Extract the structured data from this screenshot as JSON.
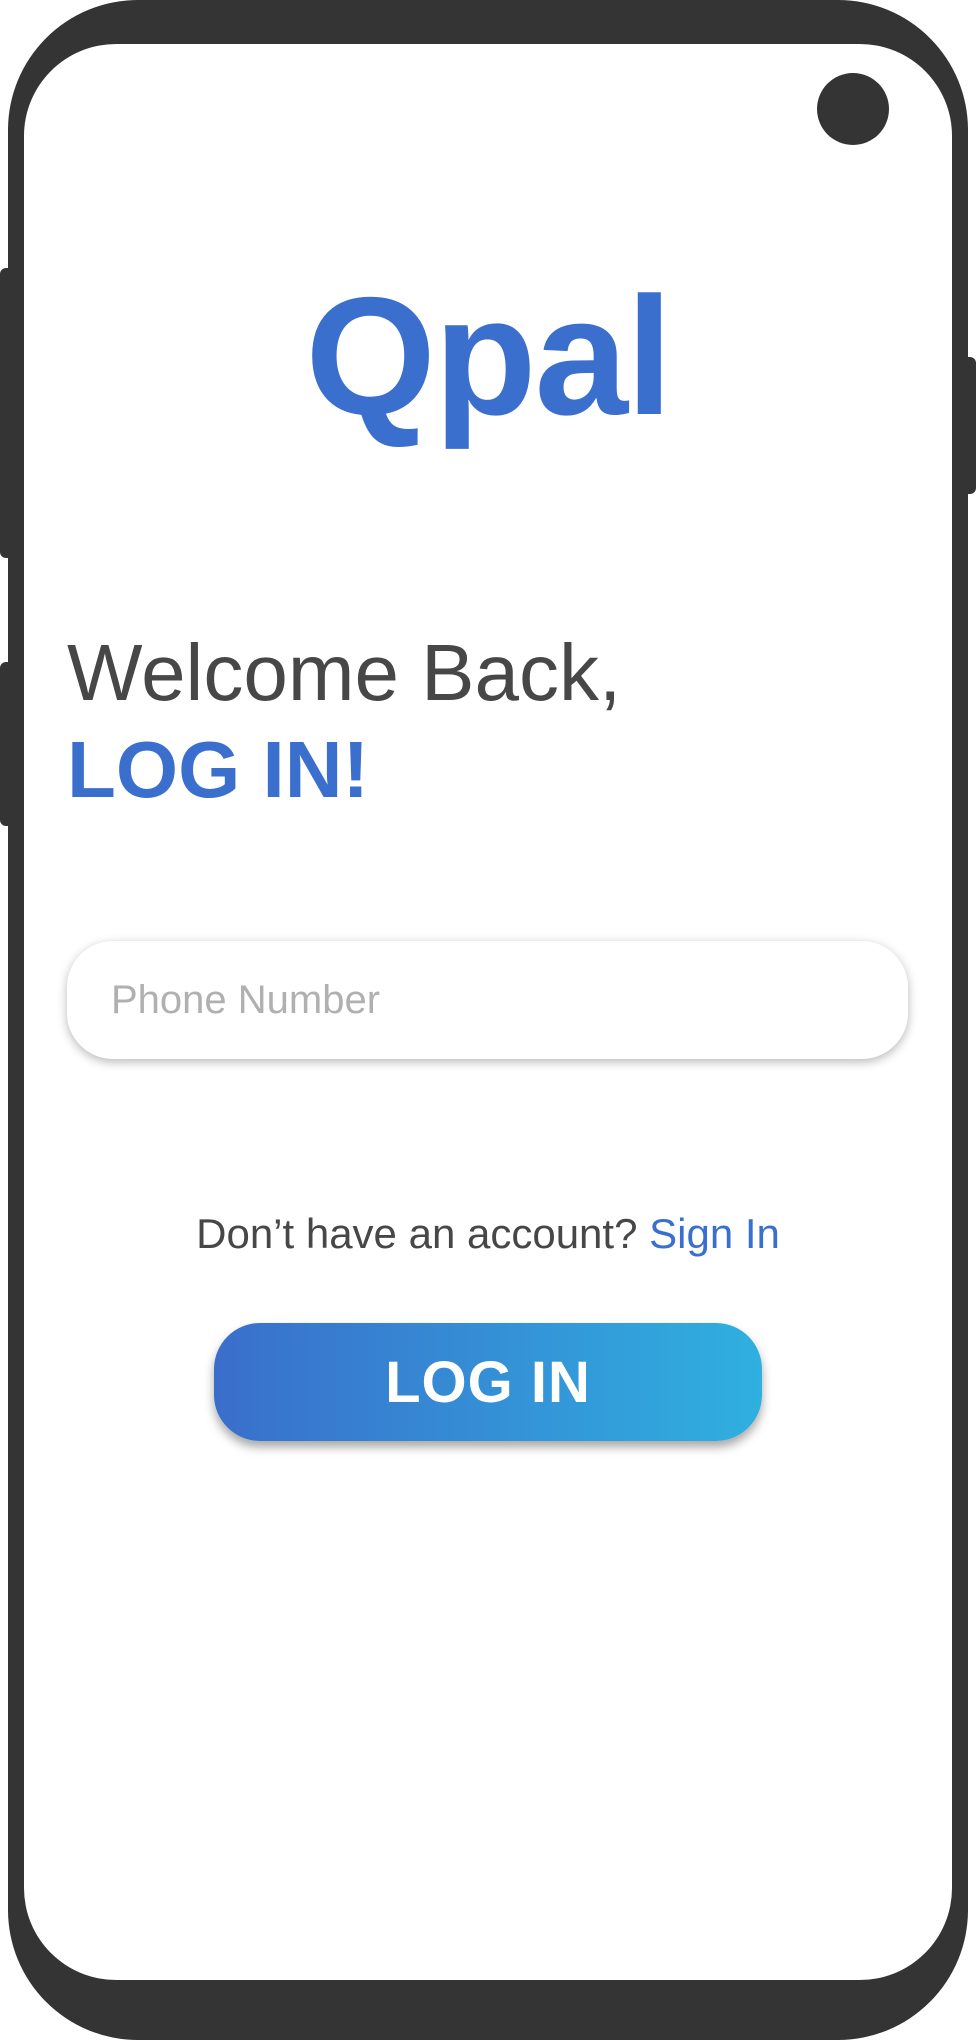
{
  "app": {
    "logo_text": "Qpal"
  },
  "login": {
    "welcome_text": "Welcome Back,",
    "heading_text": "LOG IN!",
    "phone_input": {
      "placeholder": "Phone Number",
      "value": ""
    },
    "signup_prompt": "Don’t have an account?",
    "signup_link": "Sign In",
    "submit_label": "LOG IN"
  },
  "colors": {
    "brand_blue": "#3b6fcd",
    "gradient_start": "#3a6ecb",
    "gradient_end": "#2fb0e0",
    "device_frame": "#343434",
    "text_dark": "#474747",
    "placeholder": "#b0b0b0"
  },
  "icons": {
    "front_camera": "camera-icon"
  }
}
